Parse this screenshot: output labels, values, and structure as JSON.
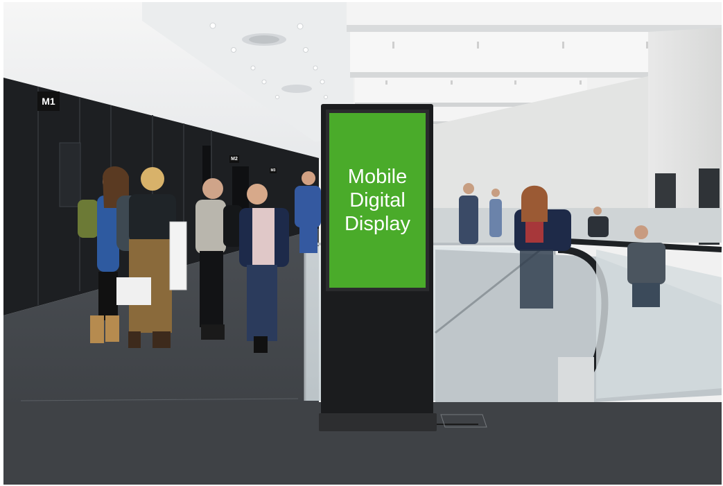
{
  "photo": {
    "subject": "conference-hall-with-kiosk",
    "kiosk_screen": {
      "lines": [
        "Mobile",
        "Digital",
        "Display"
      ],
      "screen_color": "#4aab2a"
    },
    "hall_signs": {
      "sign_1": "M1",
      "sign_2": "M2",
      "sign_3": "M3"
    }
  }
}
